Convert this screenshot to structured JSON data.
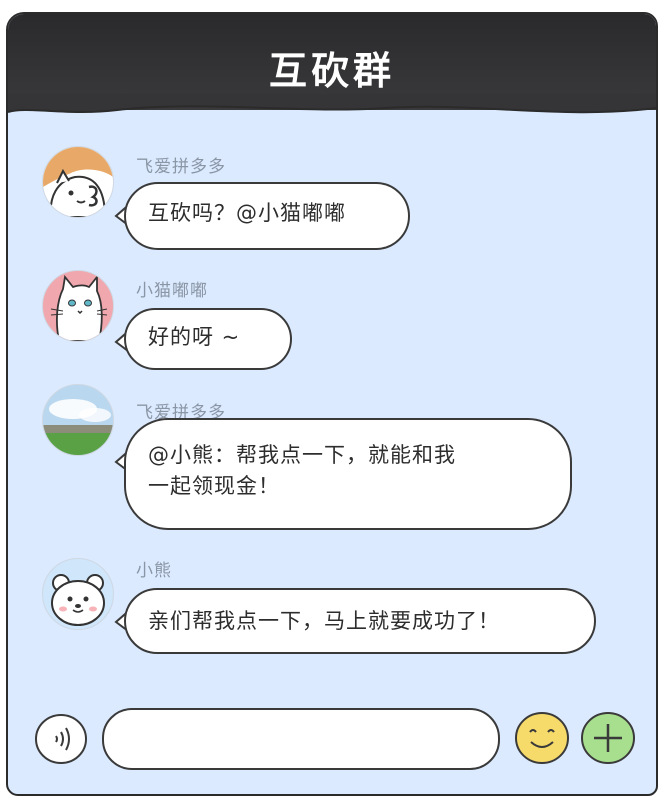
{
  "header": {
    "title": "互砍群"
  },
  "messages": [
    {
      "sender": "飞爱拼多多",
      "text": "互砍吗？@小猫嘟嘟",
      "avatar": "boy-cartoon-avatar"
    },
    {
      "sender": "小猫嘟嘟",
      "text": "好的呀 ~",
      "avatar": "white-cat-avatar"
    },
    {
      "sender": "飞爱拼多多",
      "text_line1": "@小熊：帮我点一下，就能和我",
      "text_line2": "一起领现金！",
      "avatar": "landscape-photo-avatar"
    },
    {
      "sender": "小熊",
      "text": "亲们帮我点一下，马上就要成功了！",
      "avatar": "polar-bear-avatar"
    }
  ],
  "input": {
    "voice_icon": "voice-icon",
    "emoji_icon": "smiley-icon",
    "add_icon": "plus-icon",
    "placeholder": ""
  },
  "colors": {
    "header": "#2f2f31",
    "background": "#dbeaff",
    "bubble": "#ffffff",
    "emoji": "#f6da6a",
    "add": "#a8df8e"
  }
}
